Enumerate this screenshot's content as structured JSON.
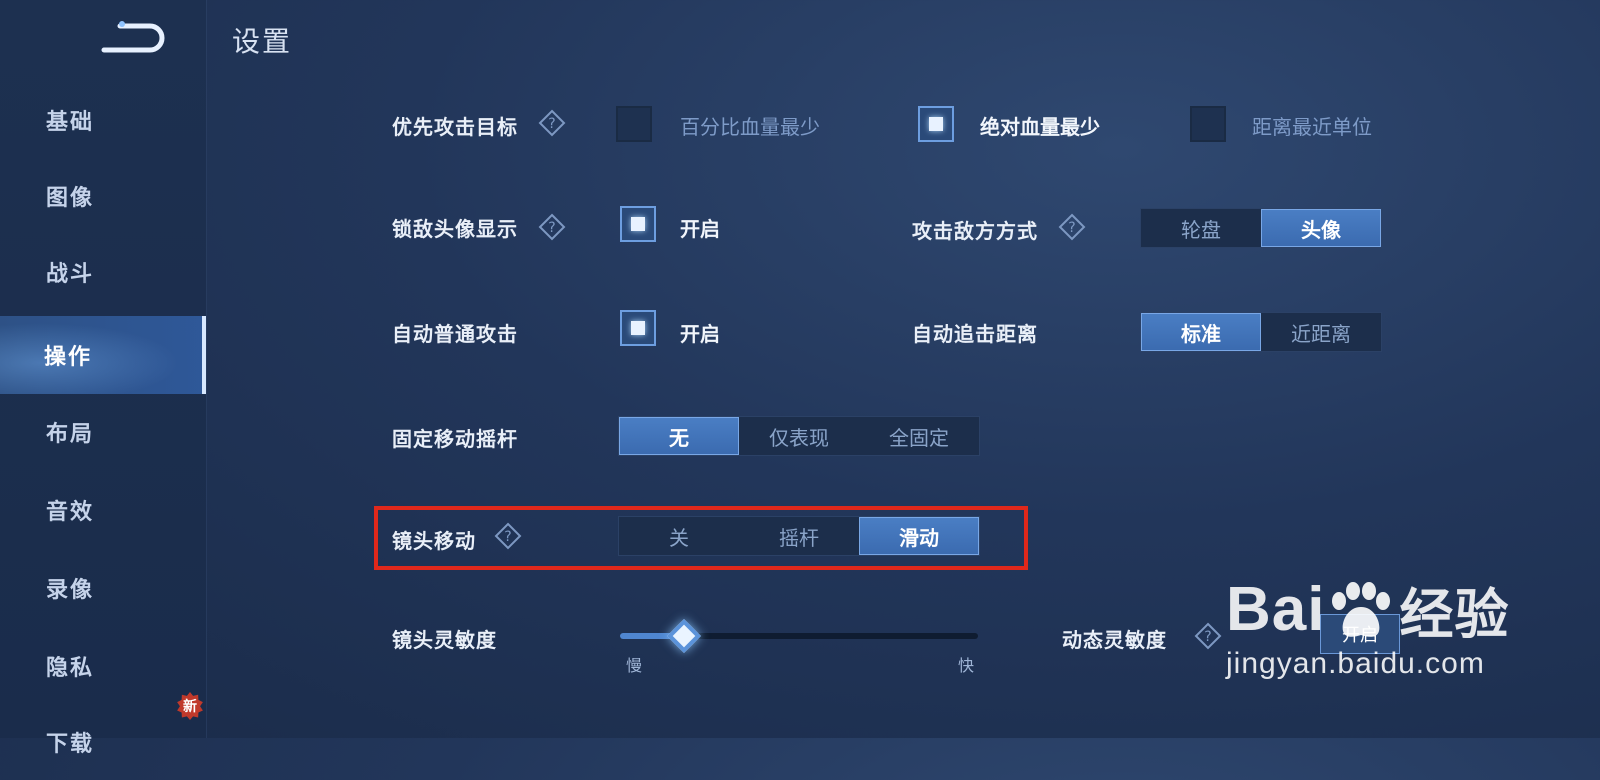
{
  "page": {
    "title": "设置"
  },
  "sidebar": {
    "items": [
      {
        "label": "基础"
      },
      {
        "label": "图像"
      },
      {
        "label": "战斗"
      },
      {
        "label": "操作",
        "active": true
      },
      {
        "label": "布局"
      },
      {
        "label": "音效"
      },
      {
        "label": "录像"
      },
      {
        "label": "隐私"
      },
      {
        "label": "下载"
      }
    ],
    "new_badge": "新"
  },
  "settings": {
    "priority_target": {
      "label": "优先攻击目标",
      "options": [
        {
          "label": "百分比血量最少",
          "checked": false
        },
        {
          "label": "绝对血量最少",
          "checked": true
        },
        {
          "label": "距离最近单位",
          "checked": false
        }
      ]
    },
    "lock_avatar": {
      "label": "锁敌头像显示",
      "option": "开启",
      "checked": true
    },
    "attack_mode": {
      "label": "攻击敌方方式",
      "options": [
        "轮盘",
        "头像"
      ],
      "selected": "头像"
    },
    "auto_attack": {
      "label": "自动普通攻击",
      "option": "开启",
      "checked": true
    },
    "auto_chase": {
      "label": "自动追击距离",
      "options": [
        "标准",
        "近距离"
      ],
      "selected": "标准"
    },
    "fixed_joystick": {
      "label": "固定移动摇杆",
      "options": [
        "无",
        "仅表现",
        "全固定"
      ],
      "selected": "无"
    },
    "camera_move": {
      "label": "镜头移动",
      "options": [
        "关",
        "摇杆",
        "滑动"
      ],
      "selected": "滑动"
    },
    "camera_sensitivity": {
      "label": "镜头灵敏度",
      "min_label": "慢",
      "max_label": "快",
      "value": 0.18
    },
    "dynamic_sensitivity": {
      "label": "动态灵敏度",
      "button": "开启"
    }
  },
  "watermark": {
    "brand": "Bai",
    "brand_suffix": "经验",
    "url": "jingyan.baidu.com"
  },
  "colors": {
    "highlight": "#e0281b",
    "accent": "#4a7ec4"
  }
}
